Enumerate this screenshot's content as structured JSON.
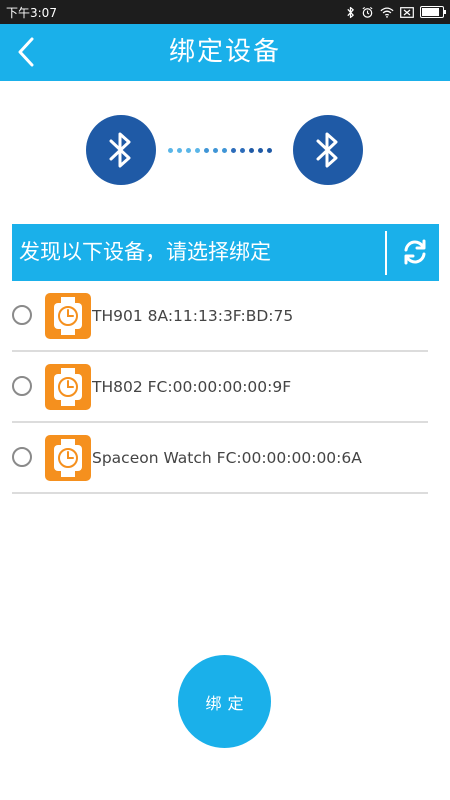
{
  "status_bar": {
    "time": "下午3:07",
    "battery_level": 0.85
  },
  "header": {
    "title": "绑定设备",
    "back_icon": "chevron-left-icon"
  },
  "bluetooth": {
    "left_icon": "bluetooth-icon",
    "right_icon": "bluetooth-icon",
    "dot_colors": [
      "#5ab6e8",
      "#5ab6e8",
      "#5ab6e8",
      "#5ab6e8",
      "#3f95d6",
      "#3f95d6",
      "#3f95d6",
      "#2c6cba",
      "#2c6cba",
      "#1f5aa6",
      "#1f5aa6",
      "#1f5aa6"
    ]
  },
  "discover": {
    "label": "发现以下设备，请选择绑定",
    "refresh_icon": "refresh-icon"
  },
  "devices": [
    {
      "label": "TH901 8A:11:13:3F:BD:75",
      "selected": false
    },
    {
      "label": "TH802 FC:00:00:00:00:9F",
      "selected": false
    },
    {
      "label": "Spaceon Watch FC:00:00:00:00:6A",
      "selected": false
    }
  ],
  "bind_button": {
    "label": "绑定"
  },
  "colors": {
    "accent": "#1ab0ea",
    "bluetooth_circle": "#1f5aa6",
    "watch_orange": "#f5901e"
  }
}
